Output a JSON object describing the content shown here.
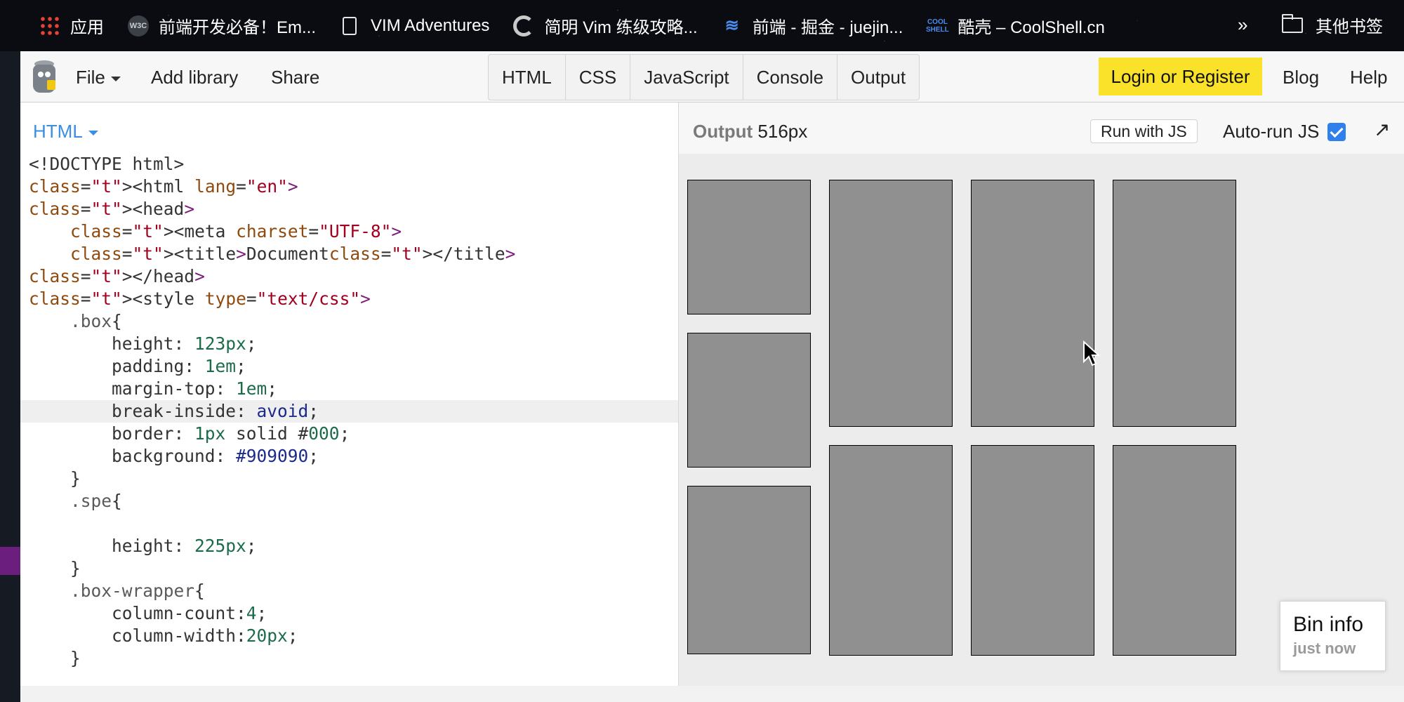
{
  "bookmarks": {
    "items": [
      {
        "label": "应用",
        "icon": "apps-grid-icon"
      },
      {
        "label": "前端开发必备！Em...",
        "icon": "w3c-icon"
      },
      {
        "label": "VIM Adventures",
        "icon": "document-icon"
      },
      {
        "label": "简明 Vim 练级攻略...",
        "icon": "coolshell-c-icon"
      },
      {
        "label": "前端 - 掘金 - juejin...",
        "icon": "juejin-icon"
      },
      {
        "label": "酷壳 – CoolShell.cn",
        "icon": "coolshell-icon"
      }
    ],
    "more": "»",
    "folder_label": "其他书签",
    "w3c_icon_text": "W3C",
    "juejin_icon_glyph": "≋",
    "cool_icon_text_1": "COOL",
    "cool_icon_text_2": "SHELL"
  },
  "toolbar": {
    "file": "File",
    "add_library": "Add library",
    "share": "Share",
    "panels": [
      "HTML",
      "CSS",
      "JavaScript",
      "Console",
      "Output"
    ],
    "login": "Login or Register",
    "blog": "Blog",
    "help": "Help"
  },
  "editor": {
    "label": "HTML",
    "lines": [
      "<!DOCTYPE html>",
      "<html lang=\"en\">",
      "<head>",
      "    <meta charset=\"UTF-8\">",
      "    <title>Document</title>",
      "</head>",
      "<style type=\"text/css\">",
      "    .box{",
      "        height: 123px;",
      "        padding: 1em;",
      "        margin-top: 1em;",
      "        break-inside: avoid;",
      "        border: 1px solid #000;",
      "        background: #909090;",
      "    }",
      "    .spe{",
      "",
      "        height: 225px;",
      "    }",
      "    .box-wrapper{",
      "        column-count:4;",
      "        column-width:20px;",
      "    }"
    ],
    "active_line": 11
  },
  "output": {
    "label": "Output",
    "width_value": "516px",
    "run_button": "Run with JS",
    "autorun_label": "Auto-run JS",
    "autorun_checked": true,
    "expand_glyph": "↗",
    "box_color": "#909090"
  },
  "bin_info": {
    "title": "Bin info",
    "time": "just now"
  },
  "colors": {
    "accent_blue": "#3a8ee6",
    "login_yellow": "#fae22a",
    "checkbox_blue": "#2f80ed"
  }
}
